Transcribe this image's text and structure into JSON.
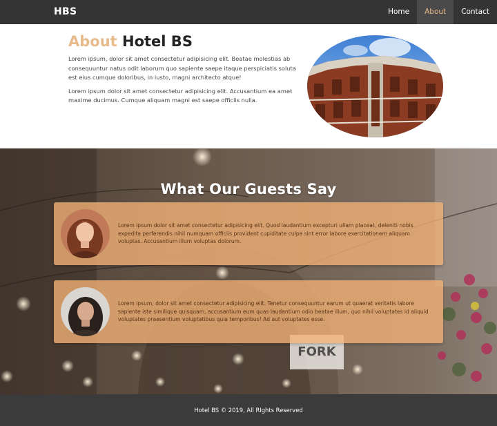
{
  "navbar": {
    "brand": "HBS",
    "links": [
      {
        "label": "Home"
      },
      {
        "label": "About"
      },
      {
        "label": "Contact"
      }
    ]
  },
  "about": {
    "title_highlight": "About",
    "title_rest": "Hotel BS",
    "paragraphs": [
      "Lorem ipsum, dolor sit amet consectetur adipisicing elit. Beatae molestias ab consequuntur natus odit laborum quo sapiente saepe itaque perspiciatis soluta est eius cumque doloribus, in iusto, magni architecto atque!",
      "Lorem ipsum dolor sit amet consectetur adipisicing elit. Accusantium ea amet maxime ducimus. Cumque aliquam magni est saepe officiis nulla."
    ]
  },
  "testimonials": {
    "title": "What Our Guests Say",
    "items": [
      {
        "text": "Lorem ipsum dolor sit amet consectetur adipisicing elit. Quod laudantium excepturi ullam placeat, deleniti nobis expedita perferendis nihil numquam officiis provident cupiditate culpa sint error labore exercitationem aliquam voluptas. Accusantium illum voluptas dolorum."
      },
      {
        "text": "Lorem ipsum, dolor sit amet consectetur adipisicing elit. Tenetur consequuntur earum ut quaerat veritatis labore sapiente iste similique quisquam, accusantium eum quas laudantium odio beatae illum, quo nihil voluptates id aliquid voluptates praesentium voluptatibus quia temporibus! Ad aut voluptates esse."
      }
    ]
  },
  "footer": {
    "text": "Hotel BS © 2019, All RIghts Reserved"
  },
  "colors": {
    "nav_bg": "#343434",
    "accent": "#e8bb8c",
    "card_bg": "#f4b276",
    "footer_bg": "#3b3b3b"
  }
}
